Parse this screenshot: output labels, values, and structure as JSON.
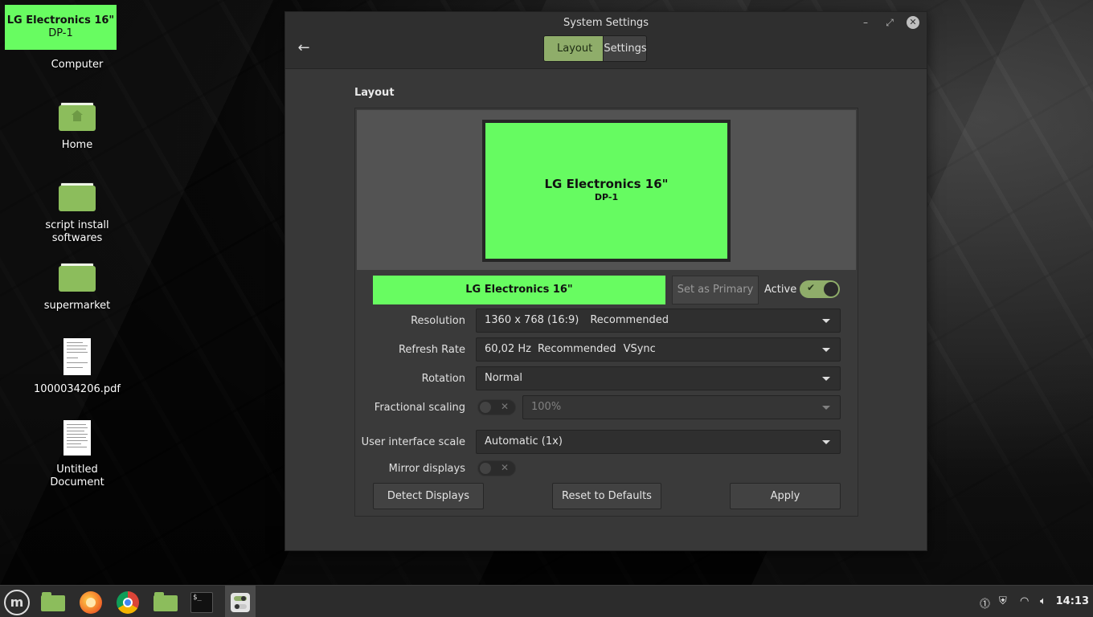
{
  "desktop": {
    "display_label": {
      "name": "LG Electronics 16\"",
      "connector": "DP-1"
    },
    "icons": [
      {
        "label": "Computer"
      },
      {
        "label": "Home"
      },
      {
        "label": "script install softwares"
      },
      {
        "label": "supermarket"
      },
      {
        "label": "1000034206.pdf"
      },
      {
        "label": "Untitled Document"
      }
    ]
  },
  "window": {
    "title": "System Settings",
    "tabs": [
      {
        "label": "Layout",
        "active": true
      },
      {
        "label": "Settings",
        "active": false
      }
    ],
    "section_title": "Layout",
    "monitor": {
      "name": "LG Electronics 16\"",
      "connector": "DP-1",
      "color": "#66fb61"
    },
    "selected_display": "LG Electronics 16\"",
    "set_primary_label": "Set as Primary",
    "active_label": "Active",
    "active": true,
    "rows": {
      "resolution": {
        "label": "Resolution",
        "value": "1360 x 768 (16:9)",
        "extra": "Recommended"
      },
      "refresh_rate": {
        "label": "Refresh Rate",
        "value": "60,02 Hz",
        "extra": "Recommended",
        "extra2": "VSync"
      },
      "rotation": {
        "label": "Rotation",
        "value": "Normal"
      },
      "fractional_scaling": {
        "label": "Fractional scaling",
        "value": "100%",
        "enabled": false
      },
      "ui_scale": {
        "label": "User interface scale",
        "value": "Automatic (1x)"
      },
      "mirror": {
        "label": "Mirror displays",
        "enabled": false
      }
    },
    "buttons": {
      "detect": "Detect Displays",
      "reset": "Reset to Defaults",
      "apply": "Apply"
    }
  },
  "taskbar": {
    "clock": "14:13"
  },
  "colors": {
    "accent": "#8fad6a",
    "display_green": "#68fc61"
  }
}
